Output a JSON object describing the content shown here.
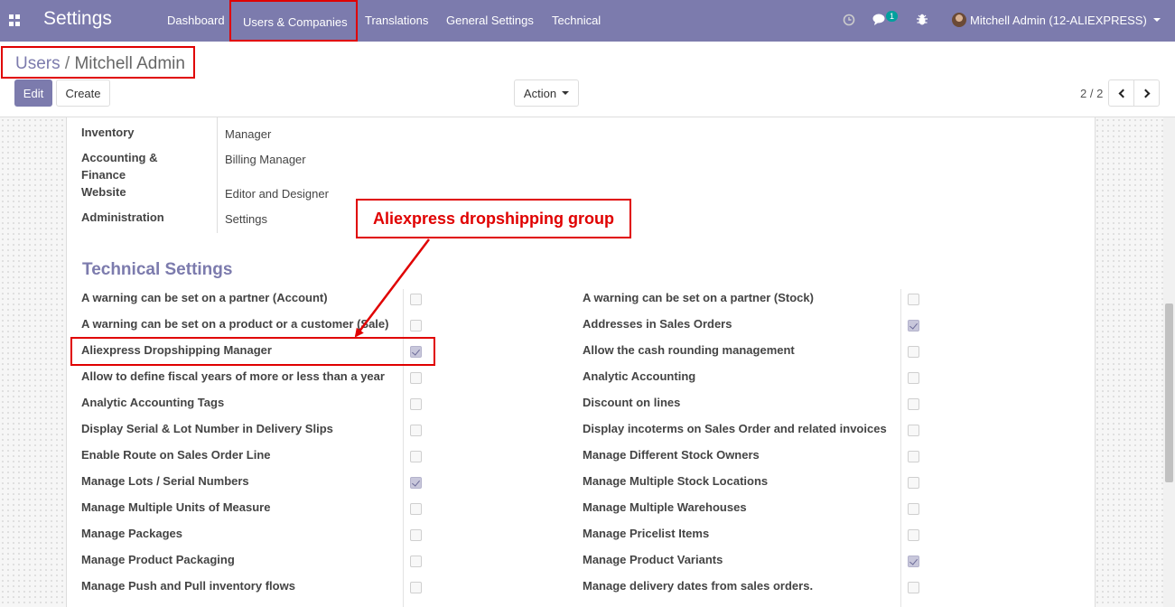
{
  "navbar": {
    "app_title": "Settings",
    "menu": [
      "Dashboard",
      "Users & Companies",
      "Translations",
      "General Settings",
      "Technical"
    ],
    "messages_badge": "1",
    "user": "Mitchell Admin (12-ALIEXPRESS)",
    "icons": {
      "clock": "clock-icon",
      "chat": "chat-icon",
      "debug": "bug-icon"
    }
  },
  "breadcrumb": {
    "parent": "Users",
    "separator": "/",
    "current": "Mitchell Admin"
  },
  "buttons": {
    "edit": "Edit",
    "create": "Create",
    "action": "Action"
  },
  "pager": {
    "value": "2 / 2"
  },
  "access_rights": [
    {
      "label": "Inventory",
      "value": "Manager"
    },
    {
      "label": "Accounting & Finance",
      "value": "Billing Manager"
    },
    {
      "label": "Website",
      "value": "Editor and Designer"
    },
    {
      "label": "Administration",
      "value": "Settings"
    }
  ],
  "technical": {
    "title": "Technical Settings",
    "left": [
      {
        "label": "A warning can be set on a partner (Account)",
        "checked": false
      },
      {
        "label": "A warning can be set on a product or a customer (Sale)",
        "checked": false
      },
      {
        "label": "Aliexpress Dropshipping Manager",
        "checked": true
      },
      {
        "label": "Allow to define fiscal years of more or less than a year",
        "checked": false
      },
      {
        "label": "Analytic Accounting Tags",
        "checked": false
      },
      {
        "label": "Display Serial & Lot Number in Delivery Slips",
        "checked": false
      },
      {
        "label": "Enable Route on Sales Order Line",
        "checked": false
      },
      {
        "label": "Manage Lots / Serial Numbers",
        "checked": true
      },
      {
        "label": "Manage Multiple Units of Measure",
        "checked": false
      },
      {
        "label": "Manage Packages",
        "checked": false
      },
      {
        "label": "Manage Product Packaging",
        "checked": false
      },
      {
        "label": "Manage Push and Pull inventory flows",
        "checked": false
      }
    ],
    "right": [
      {
        "label": "A warning can be set on a partner (Stock)",
        "checked": false
      },
      {
        "label": "Addresses in Sales Orders",
        "checked": true
      },
      {
        "label": "Allow the cash rounding management",
        "checked": false
      },
      {
        "label": "Analytic Accounting",
        "checked": false
      },
      {
        "label": "Discount on lines",
        "checked": false
      },
      {
        "label": "Display incoterms on Sales Order and related invoices",
        "checked": false
      },
      {
        "label": "Manage Different Stock Owners",
        "checked": false
      },
      {
        "label": "Manage Multiple Stock Locations",
        "checked": false
      },
      {
        "label": "Manage Multiple Warehouses",
        "checked": false
      },
      {
        "label": "Manage Pricelist Items",
        "checked": false
      },
      {
        "label": "Manage Product Variants",
        "checked": true
      },
      {
        "label": "Manage delivery dates from sales orders.",
        "checked": false
      }
    ]
  },
  "annotation": {
    "callout": "Aliexpress dropshipping group",
    "color": "#e00000"
  },
  "colors": {
    "navbar": "#7c7bad",
    "accent": "#7c7bad"
  }
}
